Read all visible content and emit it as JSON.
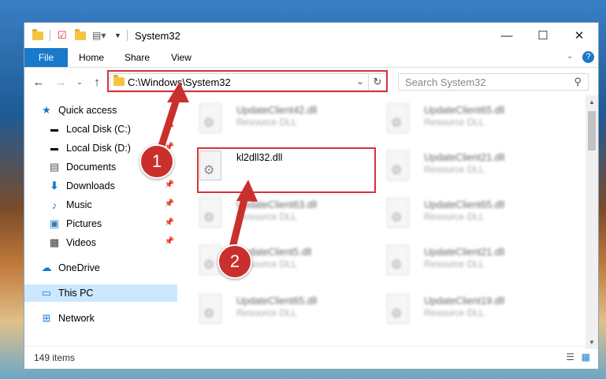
{
  "window": {
    "title": "System32",
    "controls": {
      "minimize": "—",
      "maximize": "☐",
      "close": "✕"
    }
  },
  "ribbon": {
    "tabs": [
      "File",
      "Home",
      "Share",
      "View"
    ]
  },
  "address": {
    "path": "C:\\Windows\\System32",
    "search_placeholder": "Search System32"
  },
  "sidebar": {
    "items": [
      {
        "label": "Quick access",
        "icon": "star-icon",
        "pinned": false
      },
      {
        "label": "Local Disk (C:)",
        "icon": "drive-icon",
        "pinned": true
      },
      {
        "label": "Local Disk (D:)",
        "icon": "drive-icon",
        "pinned": true
      },
      {
        "label": "Documents",
        "icon": "documents-icon",
        "pinned": true
      },
      {
        "label": "Downloads",
        "icon": "downloads-icon",
        "pinned": true
      },
      {
        "label": "Music",
        "icon": "music-icon",
        "pinned": true
      },
      {
        "label": "Pictures",
        "icon": "pictures-icon",
        "pinned": true
      },
      {
        "label": "Videos",
        "icon": "videos-icon",
        "pinned": true
      },
      {
        "label": "OneDrive",
        "icon": "onedrive-icon",
        "pinned": false
      },
      {
        "label": "This PC",
        "icon": "pc-icon",
        "pinned": false
      },
      {
        "label": "Network",
        "icon": "network-icon",
        "pinned": false
      }
    ]
  },
  "files": [
    {
      "name": "UpdateClient42.dll",
      "type": "Resource DLL"
    },
    {
      "name": "UpdateClient65.dll",
      "type": "Resource DLL"
    },
    {
      "name": "kl2dll32.dll",
      "type": ""
    },
    {
      "name": "UpdateClient21.dll",
      "type": "Resource DLL"
    },
    {
      "name": "UpdateClient63.dll",
      "type": "Resource DLL"
    },
    {
      "name": "UpdateClient65.dll",
      "type": "Resource DLL"
    },
    {
      "name": "UpdateClient5.dll",
      "type": "Resource DLL"
    },
    {
      "name": "UpdateClient21.dll",
      "type": "Resource DLL"
    },
    {
      "name": "UpdateClient65.dll",
      "type": "Resource DLL"
    },
    {
      "name": "UpdateClient19.dll",
      "type": "Resource DLL"
    }
  ],
  "status": {
    "item_count": "149 items"
  },
  "callouts": [
    "1",
    "2"
  ],
  "colors": {
    "accent": "#1979ca",
    "highlight": "#d9313a",
    "selected": "#cce8ff"
  }
}
